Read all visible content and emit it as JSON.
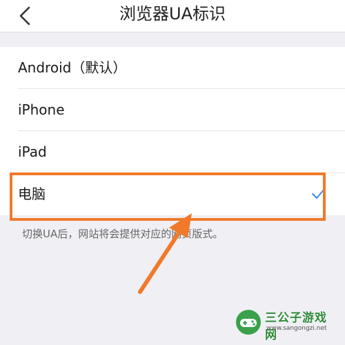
{
  "header": {
    "title": "浏览器UA标识",
    "back_icon": "chevron-left-icon"
  },
  "options": [
    {
      "label": "Android（默认）",
      "selected": false
    },
    {
      "label": "iPhone",
      "selected": false
    },
    {
      "label": "iPad",
      "selected": false
    },
    {
      "label": "电脑",
      "selected": true
    }
  ],
  "hint": "切换UA后，网站将会提供对应的网页版式。",
  "annotation": {
    "box_color": "#f07a2a",
    "arrow_color": "#f07a2a"
  },
  "watermark": {
    "title": "三公子游戏网",
    "url": "www.sangongzi.net"
  },
  "colors": {
    "check": "#3a8be6",
    "background": "#efeff4"
  }
}
